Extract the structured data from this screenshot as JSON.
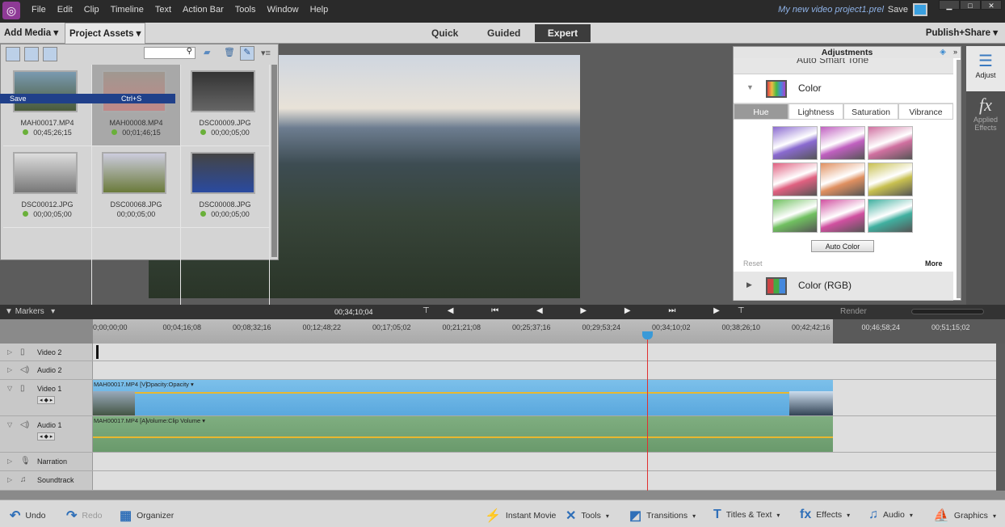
{
  "menubar": {
    "items": [
      "File",
      "Edit",
      "Clip",
      "Timeline",
      "Text",
      "Action Bar",
      "Tools",
      "Window",
      "Help"
    ],
    "project_title": "My new video project1.prel",
    "save": "Save"
  },
  "toolbar": {
    "add_media": "Add Media ▾",
    "project_assets": "Project Assets ▾",
    "modes": [
      "Quick",
      "Guided",
      "Expert"
    ],
    "selected_mode": "Expert",
    "publish": "Publish+Share ▾"
  },
  "assets": {
    "tooltip": {
      "label": "Save",
      "shortcut": "Ctrl+S"
    },
    "items": [
      {
        "name": "MAH00017.MP4",
        "duration": "00;45;26;15",
        "status": true,
        "colors": [
          "#7a9ab0",
          "#4a5a3a"
        ]
      },
      {
        "name": "MAH00008.MP4",
        "duration": "00;01;46;15",
        "status": true,
        "selected": true,
        "colors": [
          "#a09890",
          "#c08888"
        ]
      },
      {
        "name": "DSC00009.JPG",
        "duration": "00;00;05;00",
        "status": true,
        "colors": [
          "#333",
          "#666"
        ]
      },
      {
        "name": "DSC00012.JPG",
        "duration": "00;00;05;00",
        "status": true,
        "colors": [
          "#ddd",
          "#777"
        ]
      },
      {
        "name": "DSC00068.JPG",
        "duration": "00;00;05;00",
        "status": false,
        "colors": [
          "#ccd",
          "#6a7a3a"
        ]
      },
      {
        "name": "DSC00008.JPG",
        "duration": "00;00;05;00",
        "status": true,
        "colors": [
          "#444",
          "#2a4aa0"
        ]
      }
    ]
  },
  "adjustments": {
    "title": "Adjustments",
    "prev_section": "Auto Smart Tone",
    "section": "Color",
    "tabs": [
      "Hue",
      "Lightness",
      "Saturation",
      "Vibrance"
    ],
    "selected_tab": "Hue",
    "swatches": [
      "#8a6ad0",
      "#c060c0",
      "#d070a0",
      "#e06080",
      "#e09060",
      "#c8c050",
      "#70c060",
      "#d050a0",
      "#40b0a0"
    ],
    "auto_color": "Auto Color",
    "reset": "Reset",
    "more": "More",
    "next_section": "Color (RGB)"
  },
  "right_panel": {
    "adjust": "Adjust",
    "applied_effects": "Applied Effects"
  },
  "timeline": {
    "markers": "Markers",
    "timecode": "00;34;10;04",
    "render": "Render",
    "ticks": [
      "0;00;00;00",
      "00;04;16;08",
      "00;08;32;16",
      "00;12;48;22",
      "00;17;05;02",
      "00;21;21;08",
      "00;25;37;16",
      "00;29;53;24",
      "00;34;10;02",
      "00;38;26;10",
      "00;42;42;16",
      "00;46;58;24",
      "00;51;15;02"
    ],
    "tracks": [
      "Video 2",
      "Audio 2",
      "Video 1",
      "Audio 1",
      "Narration",
      "Soundtrack"
    ],
    "video_clip": {
      "name": "MAH00017.MP4 [V]",
      "effect": "Opacity:Opacity ▾"
    },
    "audio_clip": {
      "name": "MAH00017.MP4 [A]",
      "effect": "Volume:Clip Volume ▾"
    },
    "colors": {
      "video": "#7cc0ea",
      "audio": "#7fae80",
      "playhead": "#e03030"
    }
  },
  "actionbar": {
    "undo": "Undo",
    "redo": "Redo",
    "organizer": "Organizer",
    "instant_movie": "Instant Movie",
    "tools": "Tools",
    "transitions": "Transitions",
    "titles": "Titles & Text",
    "effects": "Effects",
    "audio": "Audio",
    "graphics": "Graphics"
  }
}
